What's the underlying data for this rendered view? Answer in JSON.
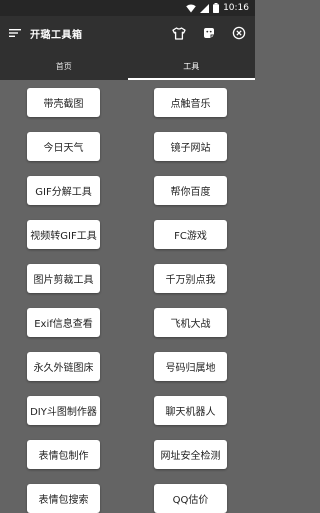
{
  "status_bar": {
    "time": "10:16"
  },
  "toolbar": {
    "title": "开璐工具箱"
  },
  "tabs": [
    {
      "label": "首页",
      "active": false
    },
    {
      "label": "工具",
      "active": true
    }
  ],
  "tools": {
    "left": [
      "带壳截图",
      "今日天气",
      "GIF分解工具",
      "视频转GIF工具",
      "图片剪裁工具",
      "Exif信息查看",
      "永久外链图床",
      "DIY斗图制作器",
      "表情包制作",
      "表情包搜索"
    ],
    "right": [
      "点触音乐",
      "镜子网站",
      "帮你百度",
      "FC游戏",
      "千万别点我",
      "飞机大战",
      "号码归属地",
      "聊天机器人",
      "网址安全检测",
      "QQ估价"
    ]
  },
  "colors": {
    "background": "#646464",
    "toolbar": "#303030",
    "status_bar": "#262626",
    "button": "#ffffff"
  }
}
